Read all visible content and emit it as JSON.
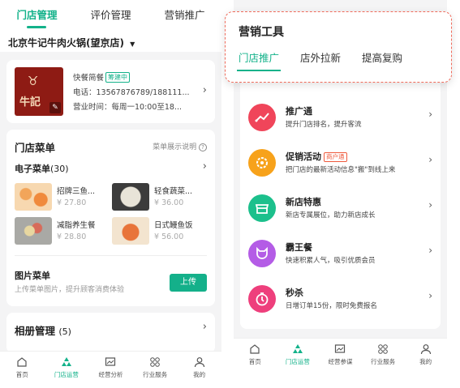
{
  "left": {
    "tabs": [
      "门店管理",
      "评价管理",
      "营销推广"
    ],
    "store_name": "北京牛记牛肉火锅(望京店)",
    "store": {
      "type": "快餐简餐",
      "status": "筹建中",
      "phone": "电话：13567876789/188111...",
      "hours": "营业时间：每周一10:00至18..."
    },
    "menu": {
      "title": "门店菜单",
      "hint": "菜单展示说明",
      "e_menu_label": "电子菜单",
      "e_menu_count": "(30)",
      "dishes": [
        {
          "name": "招牌三鱼...",
          "price": "¥ 27.80"
        },
        {
          "name": "轻食蔬菜...",
          "price": "¥ 36.00"
        },
        {
          "name": "减脂养生餐",
          "price": "¥ 28.80"
        },
        {
          "name": "日式鳗鱼饭",
          "price": "¥ 56.00"
        }
      ],
      "pic_menu_title": "图片菜单",
      "pic_menu_desc": "上传菜单图片，提升顾客消费体验",
      "upload_label": "上传"
    },
    "album": {
      "title": "相册管理",
      "count": "(5)"
    },
    "nav": [
      "首页",
      "门店运营",
      "经营分析",
      "行业服务",
      "我的"
    ]
  },
  "popup": {
    "title": "营销工具",
    "tabs": [
      "门店推广",
      "店外拉新",
      "提高复购"
    ]
  },
  "tools": [
    {
      "name": "推广通",
      "desc": "提升门店排名，提升客流",
      "color": "#f0455a",
      "icon": "trend-icon"
    },
    {
      "name": "促销活动",
      "tag": "商户通",
      "desc": "把门店的最新活动信息\"搬\"到线上来",
      "color": "#f7a21b",
      "icon": "gear-icon"
    },
    {
      "name": "新店特惠",
      "desc": "新店专属展位，助力新店成长",
      "color": "#1cc08c",
      "icon": "shop-icon"
    },
    {
      "name": "霸王餐",
      "desc": "快速积累人气，吸引优质会员",
      "color": "#b45ce6",
      "icon": "smile-icon"
    },
    {
      "name": "秒杀",
      "desc": "日增订单15份，限时免费报名",
      "color": "#ee3f7c",
      "icon": "timer-icon"
    }
  ],
  "right_nav": [
    "首页",
    "门店运营",
    "经营参谋",
    "行业服务",
    "我的"
  ],
  "accent": "#13b28a"
}
